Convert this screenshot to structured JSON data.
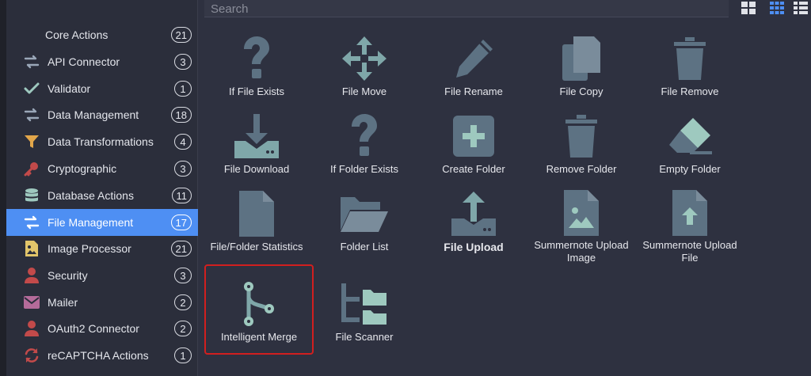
{
  "search": {
    "placeholder": "Search"
  },
  "view_buttons": [
    {
      "name": "large-grid",
      "active": false
    },
    {
      "name": "small-grid",
      "active": true
    },
    {
      "name": "list",
      "active": false
    }
  ],
  "sidebar": {
    "items": [
      {
        "label": "Core Actions",
        "count": "21",
        "icon": "none"
      },
      {
        "label": "API Connector",
        "count": "3",
        "icon": "arrows-exchange-icon"
      },
      {
        "label": "Validator",
        "count": "1",
        "icon": "check-icon"
      },
      {
        "label": "Data Management",
        "count": "18",
        "icon": "arrows-exchange-icon"
      },
      {
        "label": "Data Transformations",
        "count": "4",
        "icon": "funnel-icon"
      },
      {
        "label": "Cryptographic",
        "count": "3",
        "icon": "key-icon"
      },
      {
        "label": "Database Actions",
        "count": "11",
        "icon": "database-icon"
      },
      {
        "label": "File Management",
        "count": "17",
        "icon": "arrows-exchange-icon",
        "active": true
      },
      {
        "label": "Image Processor",
        "count": "21",
        "icon": "image-file-icon"
      },
      {
        "label": "Security",
        "count": "3",
        "icon": "user-icon"
      },
      {
        "label": "Mailer",
        "count": "2",
        "icon": "envelope-icon"
      },
      {
        "label": "OAuth2 Connector",
        "count": "2",
        "icon": "user-icon"
      },
      {
        "label": "reCAPTCHA Actions",
        "count": "1",
        "icon": "refresh-icon"
      }
    ]
  },
  "actions": [
    {
      "label": "If File Exists",
      "icon": "question-icon"
    },
    {
      "label": "File Move",
      "icon": "move-arrows-icon"
    },
    {
      "label": "File Rename",
      "icon": "pencil-icon"
    },
    {
      "label": "File Copy",
      "icon": "copy-icon"
    },
    {
      "label": "File Remove",
      "icon": "trash-icon"
    },
    {
      "label": "File Download",
      "icon": "download-icon"
    },
    {
      "label": "If Folder Exists",
      "icon": "question-icon"
    },
    {
      "label": "Create Folder",
      "icon": "plus-square-icon"
    },
    {
      "label": "Remove Folder",
      "icon": "trash-icon"
    },
    {
      "label": "Empty Folder",
      "icon": "eraser-icon"
    },
    {
      "label": "File/Folder Statistics",
      "icon": "file-icon"
    },
    {
      "label": "Folder List",
      "icon": "folder-open-icon"
    },
    {
      "label": "File Upload",
      "icon": "upload-icon"
    },
    {
      "label": "Summernote Upload Image",
      "icon": "file-image-icon"
    },
    {
      "label": "Summernote Upload File",
      "icon": "file-upload-icon"
    },
    {
      "label": "Intelligent Merge",
      "icon": "merge-icon"
    },
    {
      "label": "File Scanner",
      "icon": "folder-tree-icon"
    }
  ],
  "colors": {
    "accent": "#4e8ff3",
    "icon": "#5d7283",
    "teal_icon": "#9ec9bf",
    "selection": "#d11f1f"
  }
}
